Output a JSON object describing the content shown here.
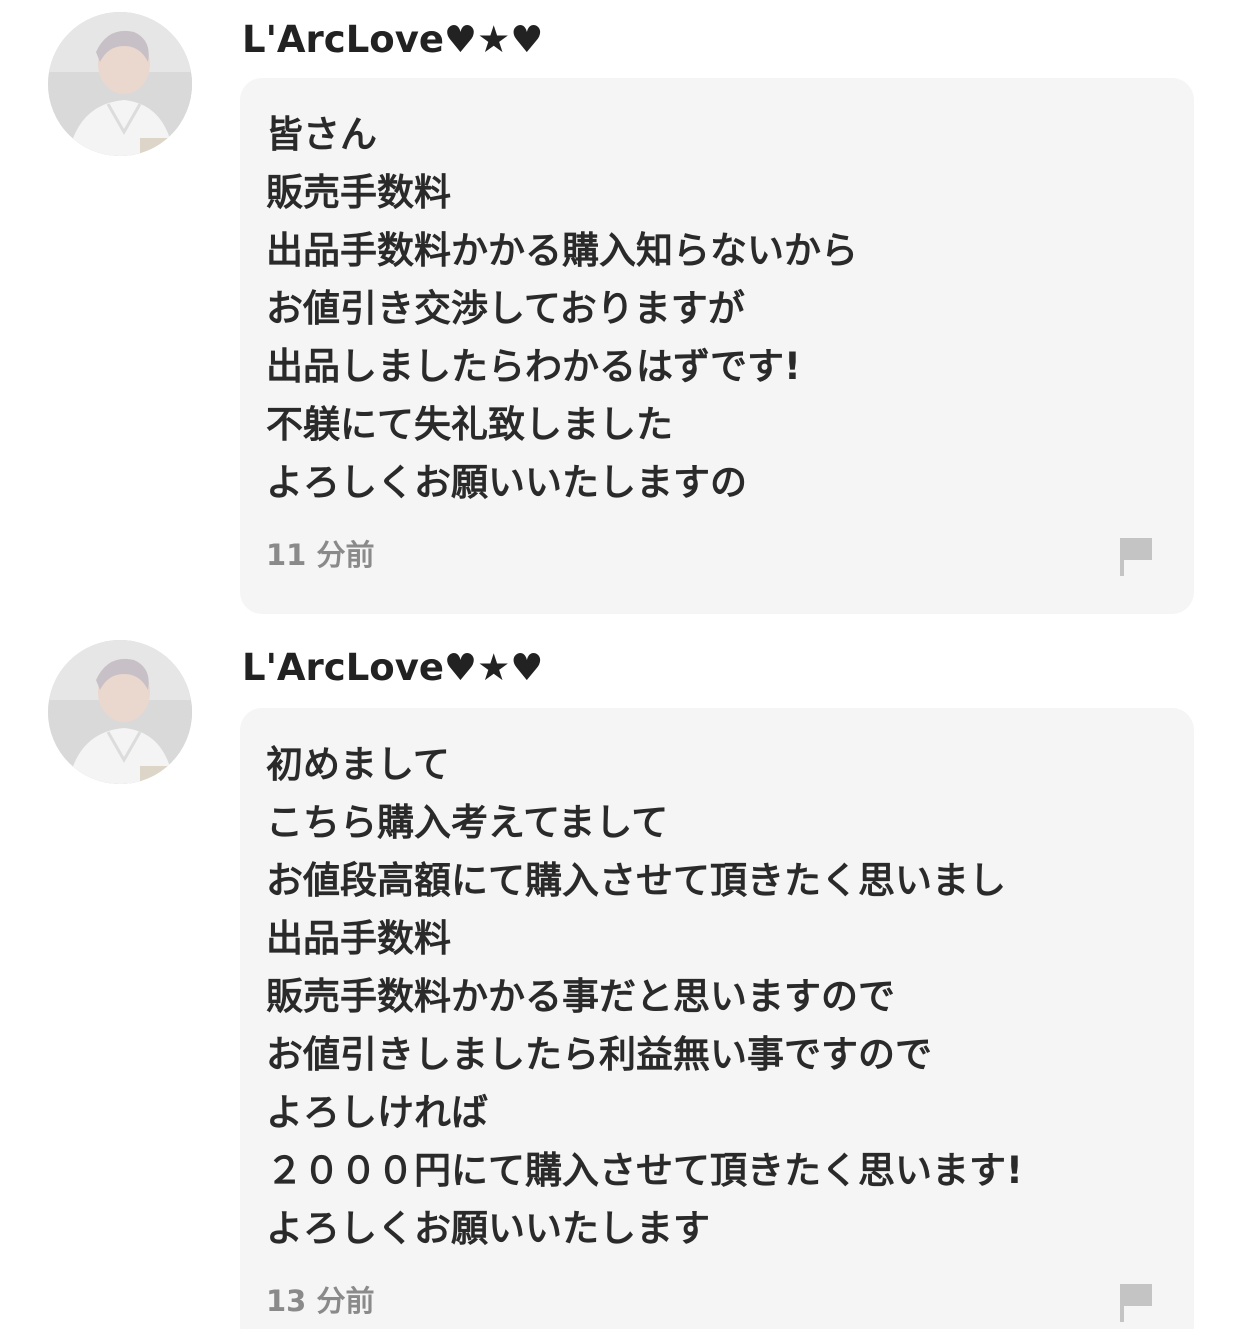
{
  "comments": [
    {
      "username": "L'ArcLove♥★♥",
      "lines": [
        "皆さん",
        "販売手数料",
        "出品手数料かかる購入知らないから",
        "お値引き交渉しておりますが",
        "出品しましたらわかるはずです!",
        "不躾にて失礼致しました",
        "よろしくお願いいたしますの"
      ],
      "time": "11 分前",
      "flag_icon": "flag-icon"
    },
    {
      "username": "L'ArcLove♥★♥",
      "lines": [
        "初めまして",
        "こちら購入考えてまして",
        "お値段高額にて購入させて頂きたく思いまし",
        "出品手数料",
        "販売手数料かかる事だと思いますので",
        "お値引きしましたら利益無い事ですので",
        "よろしければ",
        "２０００円にて購入させて頂きたく思います!",
        "よろしくお願いいたします"
      ],
      "time": "13 分前",
      "flag_icon": "flag-icon"
    }
  ],
  "colors": {
    "bubble_bg": "#f5f5f5",
    "text": "#2a2a2a",
    "timestamp": "#8a8a8a",
    "flag": "#c4c4c4"
  }
}
